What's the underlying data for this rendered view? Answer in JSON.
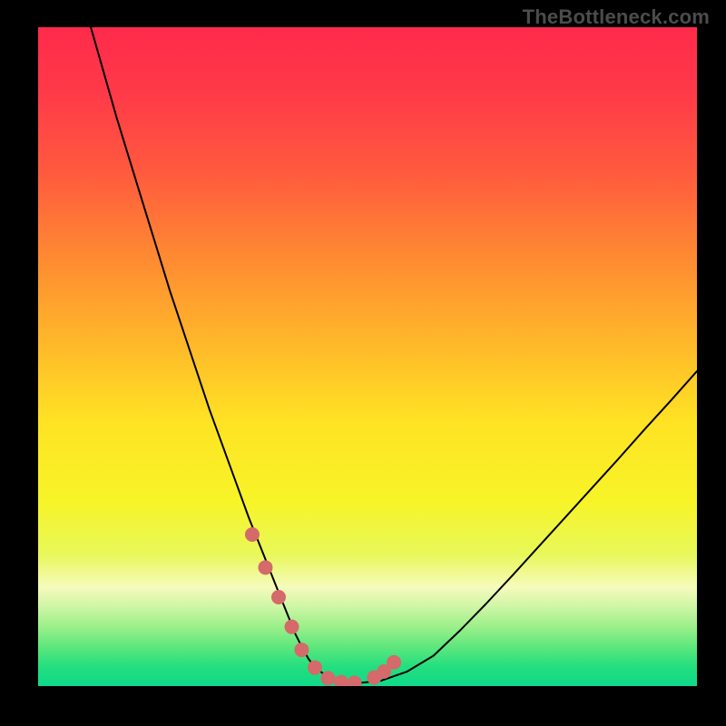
{
  "watermark": "TheBottleneck.com",
  "chart_data": {
    "type": "line",
    "title": "",
    "xlabel": "",
    "ylabel": "",
    "xlim": [
      0,
      100
    ],
    "ylim": [
      0,
      100
    ],
    "grid": false,
    "legend": false,
    "annotations": [],
    "background_gradient": {
      "stops": [
        {
          "offset": 0.0,
          "color": "#ff2a4b"
        },
        {
          "offset": 0.1,
          "color": "#ff3a48"
        },
        {
          "offset": 0.22,
          "color": "#ff5a3e"
        },
        {
          "offset": 0.35,
          "color": "#ff8a32"
        },
        {
          "offset": 0.48,
          "color": "#ffb82a"
        },
        {
          "offset": 0.6,
          "color": "#ffe324"
        },
        {
          "offset": 0.72,
          "color": "#f7f428"
        },
        {
          "offset": 0.8,
          "color": "#e8f85a"
        },
        {
          "offset": 0.85,
          "color": "#f6fabc"
        },
        {
          "offset": 0.88,
          "color": "#cdf6a4"
        },
        {
          "offset": 0.91,
          "color": "#9bef8a"
        },
        {
          "offset": 0.94,
          "color": "#5fe77d"
        },
        {
          "offset": 0.97,
          "color": "#24df7e"
        },
        {
          "offset": 1.0,
          "color": "#0fd98a"
        }
      ]
    },
    "series": [
      {
        "name": "bottleneck-curve",
        "color": "#000000",
        "width": 2.0,
        "x": [
          8,
          10,
          12,
          14,
          16,
          18,
          20,
          22,
          24,
          26,
          28,
          30,
          32,
          33,
          34,
          35,
          36,
          37,
          38,
          39,
          40,
          41,
          42,
          44,
          46,
          48,
          52,
          56,
          60,
          64,
          68,
          72,
          76,
          80,
          84,
          88,
          92,
          96,
          100
        ],
        "y": [
          100,
          93,
          86,
          79.5,
          73,
          66.5,
          60,
          54,
          48,
          42,
          36.5,
          31,
          25.5,
          23,
          20.5,
          18,
          15.5,
          13,
          10.5,
          8,
          6,
          4.2,
          2.8,
          1.4,
          0.6,
          0.4,
          0.8,
          2.2,
          4.6,
          8.4,
          12.5,
          16.8,
          21.2,
          25.6,
          30.0,
          34.4,
          38.9,
          43.3,
          47.8
        ]
      },
      {
        "name": "highlight-dots",
        "type": "scatter",
        "color": "#d46a6a",
        "radius": 8,
        "x": [
          32.5,
          34.5,
          36.5,
          38.5,
          40.0,
          42.0,
          44.0,
          46.0,
          48.0,
          51.0,
          52.5,
          54.0
        ],
        "y": [
          23.0,
          18.0,
          13.5,
          9.0,
          5.5,
          2.8,
          1.2,
          0.6,
          0.5,
          1.3,
          2.2,
          3.6
        ]
      }
    ]
  }
}
